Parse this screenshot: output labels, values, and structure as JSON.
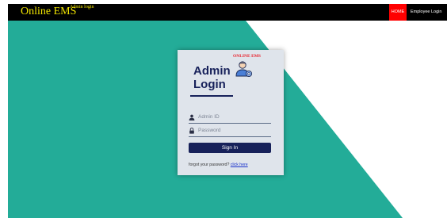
{
  "header": {
    "brand": "Online EMS",
    "subtitle": "Admin login",
    "nav_home": "HOME",
    "nav_employee": "Employee Login"
  },
  "card": {
    "tag": "ONLINE EMS",
    "title_line1": "Admin",
    "title_line2": "Login",
    "admin_id_placeholder": "Admin ID",
    "password_placeholder": "Password",
    "signin_label": "Sign In",
    "forgot_text": "forgot your password?",
    "forgot_link": "click here"
  },
  "colors": {
    "teal": "#23ac98",
    "header_bg": "#000000",
    "brand_yellow": "#f2e600",
    "home_red": "#ff0000",
    "navy": "#17215a"
  }
}
